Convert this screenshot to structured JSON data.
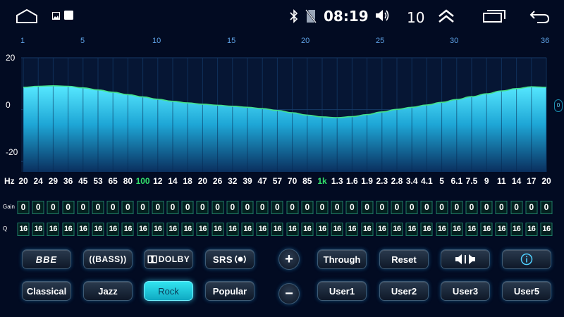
{
  "status_bar": {
    "time": "08:19",
    "volume": "10",
    "icons": [
      "home-icon",
      "gallery-icon",
      "notification-icon",
      "bluetooth-icon",
      "no-sim-icon",
      "volume-icon",
      "chevron-up-icon",
      "recent-apps-icon",
      "back-icon"
    ]
  },
  "band_index_labels": [
    "1",
    "5",
    "10",
    "15",
    "20",
    "25",
    "30",
    "36"
  ],
  "y_axis": {
    "labels": [
      "20",
      "0",
      "-20"
    ],
    "range": [
      -24,
      20
    ],
    "side_marker": "0"
  },
  "chart_data": {
    "type": "area",
    "bands": 36,
    "ylim": [
      -24,
      20
    ],
    "values": [
      8.6,
      9.0,
      9.2,
      9.0,
      8.4,
      7.6,
      6.7,
      5.8,
      4.9,
      4.0,
      3.2,
      2.6,
      2.1,
      1.7,
      1.3,
      0.9,
      0.4,
      -0.3,
      -1.2,
      -2.1,
      -2.8,
      -3.1,
      -2.7,
      -1.9,
      -0.9,
      0.1,
      0.9,
      1.8,
      2.8,
      3.9,
      5.0,
      6.1,
      7.2,
      8.1,
      8.8,
      8.6
    ],
    "y_labels": [
      "20",
      "0",
      "-20"
    ]
  },
  "frequency_row": {
    "unit": "Hz",
    "labels": [
      "20",
      "24",
      "29",
      "36",
      "45",
      "53",
      "65",
      "80",
      "100",
      "12",
      "14",
      "18",
      "20",
      "26",
      "32",
      "39",
      "47",
      "57",
      "70",
      "85",
      "1k",
      "1.3",
      "1.6",
      "1.9",
      "2.3",
      "2.8",
      "3.4",
      "4.1",
      "5",
      "6.1",
      "7.5",
      "9",
      "11",
      "14",
      "17",
      "20"
    ],
    "highlighted": [
      "100",
      "1k"
    ]
  },
  "gain": {
    "label": "Gain",
    "values": [
      "0",
      "0",
      "0",
      "0",
      "0",
      "0",
      "0",
      "0",
      "0",
      "0",
      "0",
      "0",
      "0",
      "0",
      "0",
      "0",
      "0",
      "0",
      "0",
      "0",
      "0",
      "0",
      "0",
      "0",
      "0",
      "0",
      "0",
      "0",
      "0",
      "0",
      "0",
      "0",
      "0",
      "0",
      "0",
      "0"
    ]
  },
  "q": {
    "label": "Q",
    "values": [
      "16",
      "16",
      "16",
      "16",
      "16",
      "16",
      "16",
      "16",
      "16",
      "16",
      "16",
      "16",
      "16",
      "16",
      "16",
      "16",
      "16",
      "16",
      "16",
      "16",
      "16",
      "16",
      "16",
      "16",
      "16",
      "16",
      "16",
      "16",
      "16",
      "16",
      "16",
      "16",
      "16",
      "16",
      "16",
      "16"
    ]
  },
  "effects": {
    "bbe": "BBE",
    "bass": "((BASS))",
    "dolby": "DOLBY",
    "srs": "SRS"
  },
  "presets": {
    "classical": "Classical",
    "jazz": "Jazz",
    "rock": "Rock",
    "popular": "Popular",
    "active": "Rock"
  },
  "controls": {
    "plus": "+",
    "minus": "−",
    "through": "Through",
    "reset": "Reset",
    "balance_icon": "speaker-balance-icon",
    "info_icon": "info-icon",
    "user1": "User1",
    "user2": "User2",
    "user3": "User3",
    "user5": "User5"
  },
  "colors": {
    "background": "#020b22",
    "graph_fill_top": "#4fe3ff",
    "graph_fill_bottom": "#0a3a6b",
    "highlight_freq": "#33e06b",
    "active_button": "#22cfe3"
  }
}
